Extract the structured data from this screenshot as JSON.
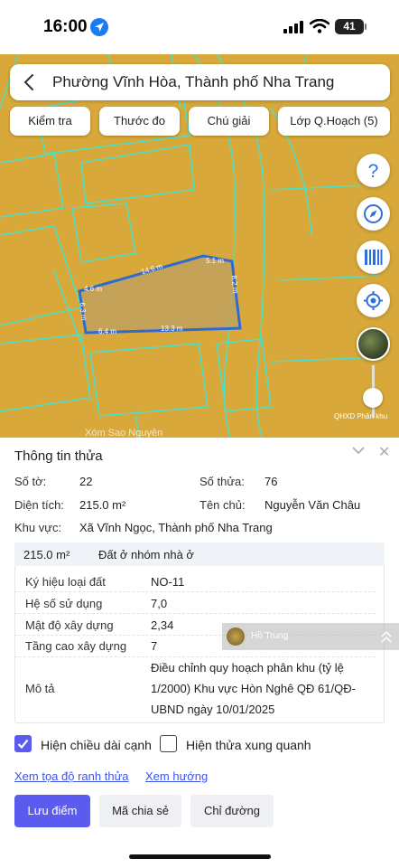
{
  "status_bar": {
    "time": "16:00",
    "battery": "41"
  },
  "search": {
    "text": "Phường Vĩnh Hòa, Thành phố Nha Trang"
  },
  "map_buttons": [
    {
      "label": "Kiểm tra"
    },
    {
      "label": "Thước đo"
    },
    {
      "label": "Chú giải"
    },
    {
      "label": "Lớp Q.Hoạch (5)"
    }
  ],
  "map": {
    "edge_labels": [
      "14.6 m",
      "5.1 m",
      "8.2 m",
      "4.6 m",
      "6.3 m",
      "6.4 m",
      "13.3 m"
    ],
    "layer_label": "QHXD Phân khu",
    "road_label": "Xóm Sao Nguyên"
  },
  "panel": {
    "title": "Thông tin thửa",
    "so_to_label": "Số tờ:",
    "so_to": "22",
    "so_thua_label": "Số thửa:",
    "so_thua": "76",
    "dien_tich_label": "Diện tích:",
    "dien_tich": "215.0 m²",
    "ten_chu_label": "Tên chủ:",
    "ten_chu": "Nguyễn Văn Châu",
    "khu_vuc_label": "Khu vực:",
    "khu_vuc": "Xã Vĩnh Ngọc, Thành phố Nha Trang",
    "box_area": "215.0 m²",
    "box_type": "Đất ở nhóm nhà ở",
    "rows": [
      {
        "label": "Ký hiệu loại đất",
        "value": "NO-11"
      },
      {
        "label": "Hệ số sử dụng",
        "value": "7,0"
      },
      {
        "label": "Mật độ xây dựng",
        "value": "2,34"
      },
      {
        "label": "Tầng cao xây dựng",
        "value": "7"
      }
    ],
    "mo_ta_label": "Mô tả",
    "mo_ta_lines": [
      "Điều chỉnh quy hoạch phân khu (tỷ lệ",
      "1/2000) Khu vực Hòn Nghê QĐ 61/QĐ-",
      "UBND ngày 10/01/2025"
    ]
  },
  "overlay": {
    "name": "Hồ Trung"
  },
  "checkboxes": [
    {
      "label": "Hiện chiều dài cạnh",
      "checked": true
    },
    {
      "label": "Hiện thửa xung quanh",
      "checked": false
    }
  ],
  "links": [
    {
      "label": "Xem tọa độ ranh thửa"
    },
    {
      "label": "Xem hướng"
    }
  ],
  "actions": [
    {
      "label": "Lưu điểm"
    },
    {
      "label": "Mã chia sẻ"
    },
    {
      "label": "Chỉ đường"
    }
  ]
}
